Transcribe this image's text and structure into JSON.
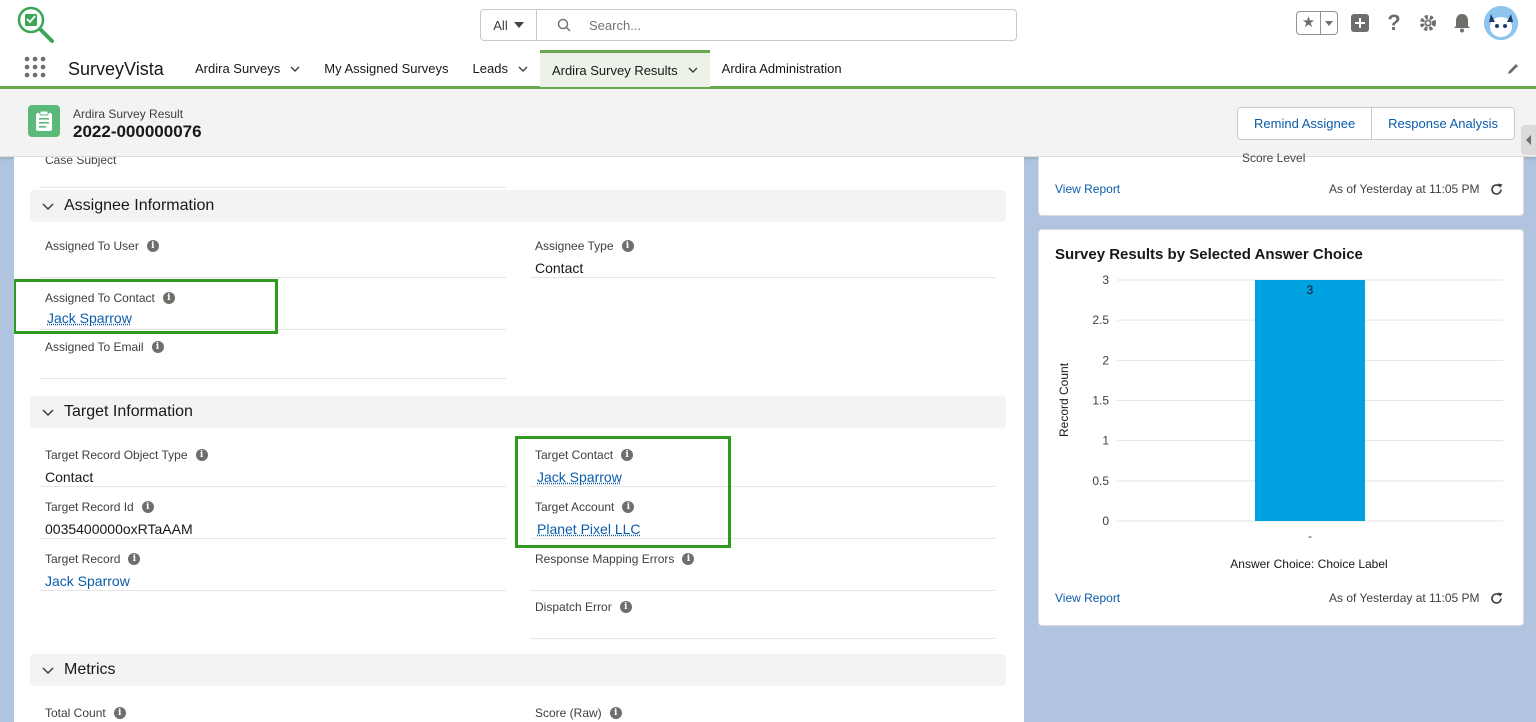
{
  "header": {
    "search_scope": "All",
    "search_placeholder": "Search...",
    "icons": [
      "favorites-star-icon",
      "add-icon",
      "help-icon",
      "settings-gear-icon",
      "notifications-bell-icon",
      "avatar"
    ]
  },
  "nav": {
    "app_name": "SurveyVista",
    "items": [
      {
        "label": "Ardira Surveys",
        "has_menu": true,
        "active": false
      },
      {
        "label": "My Assigned Surveys",
        "has_menu": false,
        "active": false
      },
      {
        "label": "Leads",
        "has_menu": true,
        "active": false
      },
      {
        "label": "Ardira Survey Results",
        "has_menu": true,
        "active": true
      },
      {
        "label": "Ardira Administration",
        "has_menu": false,
        "active": false
      }
    ]
  },
  "record": {
    "type": "Ardira Survey Result",
    "title": "2022-000000076",
    "actions": [
      "Remind Assignee",
      "Response Analysis"
    ]
  },
  "main": {
    "cut_label": "Case Subject",
    "sections": {
      "assignee": {
        "title": "Assignee Information",
        "fields": {
          "assigned_to_user": {
            "label": "Assigned To User",
            "value": ""
          },
          "assignee_type": {
            "label": "Assignee Type",
            "value": "Contact"
          },
          "assigned_to_contact": {
            "label": "Assigned To Contact",
            "value": "Jack Sparrow"
          },
          "assigned_to_email": {
            "label": "Assigned To Email",
            "value": ""
          }
        }
      },
      "target": {
        "title": "Target Information",
        "fields": {
          "target_record_object_type": {
            "label": "Target Record Object Type",
            "value": "Contact"
          },
          "target_contact": {
            "label": "Target Contact",
            "value": "Jack Sparrow"
          },
          "target_record_id": {
            "label": "Target Record Id",
            "value": "0035400000oxRTaAAM"
          },
          "target_account": {
            "label": "Target Account",
            "value": "Planet Pixel LLC"
          },
          "target_record": {
            "label": "Target Record",
            "value": "Jack Sparrow"
          },
          "response_mapping_errors": {
            "label": "Response Mapping Errors",
            "value": ""
          },
          "dispatch_error": {
            "label": "Dispatch Error",
            "value": ""
          }
        }
      },
      "metrics": {
        "title": "Metrics",
        "fields": {
          "total_count": {
            "label": "Total Count",
            "value": ""
          },
          "score_raw": {
            "label": "Score (Raw)",
            "value": ""
          }
        }
      }
    }
  },
  "side": {
    "top_card": {
      "cut_label": "Score Level",
      "view_report": "View Report",
      "as_of": "As of Yesterday at 11:05 PM"
    },
    "chart_card": {
      "title": "Survey Results by Selected Answer Choice",
      "view_report": "View Report",
      "as_of": "As of Yesterday at 11:05 PM"
    }
  },
  "chart_data": {
    "type": "bar",
    "title": "Survey Results by Selected Answer Choice",
    "categories": [
      "-"
    ],
    "values": [
      3
    ],
    "data_labels": [
      "3"
    ],
    "xlabel": "Answer Choice: Choice Label",
    "ylabel": "Record Count",
    "ylim": [
      0,
      3
    ],
    "yticks": [
      0,
      0.5,
      1,
      1.5,
      2,
      2.5,
      3
    ],
    "grid": true,
    "bar_color": "#00a1e0"
  },
  "colors": {
    "accent_green": "#6aa84f",
    "highlight_green": "#2e9a1e",
    "link_blue": "#0b5cab",
    "page_bg": "#b0c4df",
    "record_icon_green": "#5bb97a"
  }
}
